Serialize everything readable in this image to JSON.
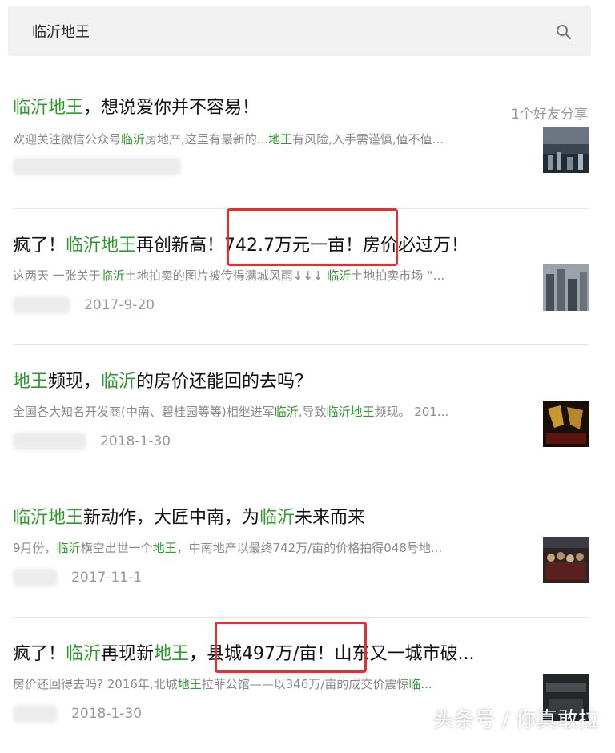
{
  "search": {
    "query": "临沂地王"
  },
  "results": [
    {
      "title": [
        {
          "t": "临沂地王",
          "hl": true
        },
        {
          "t": "，想说爱你并不容易！",
          "hl": false
        }
      ],
      "desc": [
        {
          "t": "欢迎关注微信公众号",
          "hl": false
        },
        {
          "t": "临沂",
          "hl": true
        },
        {
          "t": "房地产,这里有最新的...",
          "hl": false
        },
        {
          "t": "地王",
          "hl": true
        },
        {
          "t": "有风险,入手需谨慎,值不值...",
          "hl": false
        }
      ],
      "date": "",
      "share": "1个好友分享"
    },
    {
      "title": [
        {
          "t": "疯了！",
          "hl": false
        },
        {
          "t": "临沂地王",
          "hl": true
        },
        {
          "t": "再创新高！742.7万元一亩！房价必过万！",
          "hl": false
        }
      ],
      "desc": [
        {
          "t": "这两天 一张关于",
          "hl": false
        },
        {
          "t": "临沂",
          "hl": true
        },
        {
          "t": "土地拍卖的图片被传得满城风雨↓↓↓ ",
          "hl": false
        },
        {
          "t": "临沂",
          "hl": true
        },
        {
          "t": "土地拍卖市场 “...",
          "hl": false
        }
      ],
      "date": "2017-9-20"
    },
    {
      "title": [
        {
          "t": "地王",
          "hl": true
        },
        {
          "t": "频现，",
          "hl": false
        },
        {
          "t": "临沂",
          "hl": true
        },
        {
          "t": "的房价还能回的去吗？",
          "hl": false
        }
      ],
      "desc": [
        {
          "t": "全国各大知名开发商(中南、碧桂园等等)相继进军",
          "hl": false
        },
        {
          "t": "临沂",
          "hl": true
        },
        {
          "t": ",导致",
          "hl": false
        },
        {
          "t": "临沂地王",
          "hl": true
        },
        {
          "t": "频现。 201...",
          "hl": false
        }
      ],
      "date": "2018-1-30"
    },
    {
      "title": [
        {
          "t": "临沂地王",
          "hl": true
        },
        {
          "t": "新动作，大匠中南，为",
          "hl": false
        },
        {
          "t": "临沂",
          "hl": true
        },
        {
          "t": "未来而来",
          "hl": false
        }
      ],
      "desc": [
        {
          "t": "9月份，",
          "hl": false
        },
        {
          "t": "临沂",
          "hl": true
        },
        {
          "t": "横空出世一个",
          "hl": false
        },
        {
          "t": "地王",
          "hl": true
        },
        {
          "t": "，中南地产以最终742万/亩的价格拍得048号地...",
          "hl": false
        }
      ],
      "date": "2017-11-1"
    },
    {
      "title": [
        {
          "t": "疯了！",
          "hl": false
        },
        {
          "t": "临沂",
          "hl": true
        },
        {
          "t": "再现新",
          "hl": false
        },
        {
          "t": "地王",
          "hl": true
        },
        {
          "t": "，县城497万/亩！山东又一城市破...",
          "hl": false
        }
      ],
      "desc": [
        {
          "t": "房价还回得去吗? 2016年,北城",
          "hl": false
        },
        {
          "t": "地王",
          "hl": true
        },
        {
          "t": "拉菲公馆——以346万/亩的成交价震惊",
          "hl": false
        },
        {
          "t": "临...",
          "hl": true
        }
      ],
      "date": "2018-1-30"
    }
  ],
  "watermark": "头条号 / 你真敢拉",
  "colors": {
    "highlight": "#2e9a2e",
    "red_box": "#e03030",
    "search_bg": "#f2f2f2"
  },
  "icons": {
    "search": "search-icon"
  }
}
